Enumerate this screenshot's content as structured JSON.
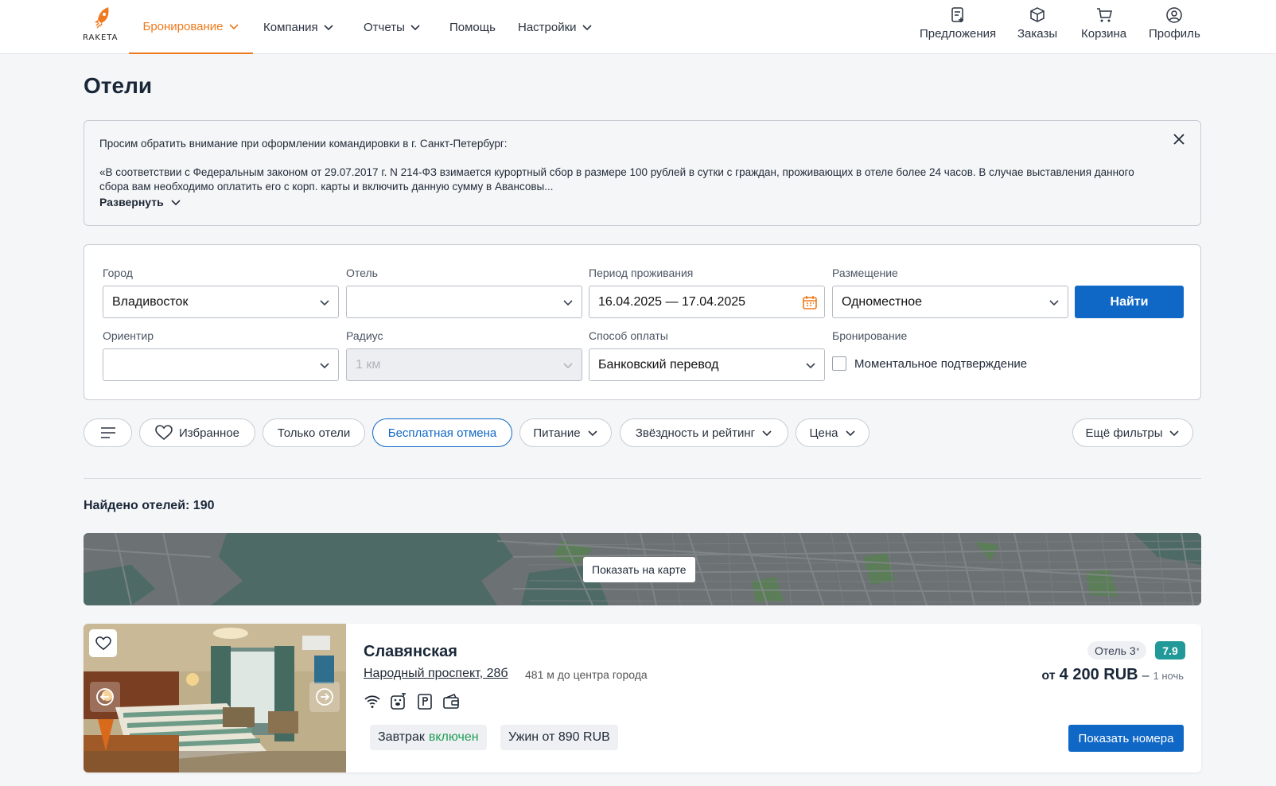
{
  "app": {
    "logo_text": "RAKETA"
  },
  "nav": {
    "items": [
      {
        "label": "Бронирование",
        "active": true,
        "dropdown": true
      },
      {
        "label": "Компания",
        "dropdown": true
      },
      {
        "label": "Отчеты",
        "dropdown": true
      },
      {
        "label": "Помощь",
        "dropdown": false
      },
      {
        "label": "Настройки",
        "dropdown": true
      }
    ],
    "right": [
      {
        "label": "Предложения",
        "icon": "offers-icon"
      },
      {
        "label": "Заказы",
        "icon": "box-icon"
      },
      {
        "label": "Корзина",
        "icon": "cart-icon"
      },
      {
        "label": "Профиль",
        "icon": "user-icon"
      }
    ]
  },
  "page": {
    "title": "Отели"
  },
  "notice": {
    "line1": "Просим обратить внимание при оформлении командировки в г. Санкт-Петербург:",
    "line2": "«В соответствии с Федеральным законом от 29.07.2017 г. N 214-ФЗ взимается курортный сбор в размере 100 рублей в сутки с граждан, проживающих в отеле более 24 часов. В случае выставления данного сбора вам необходимо оплатить его с корп. карты и включить данную сумму в Авансовы...",
    "expand_label": "Развернуть"
  },
  "search": {
    "city_label": "Город",
    "city_value": "Владивосток",
    "hotel_label": "Отель",
    "hotel_value": "",
    "period_label": "Период проживания",
    "period_value": "16.04.2025 — 17.04.2025",
    "placement_label": "Размещение",
    "placement_value": "Одноместное",
    "find_button": "Найти",
    "landmark_label": "Ориентир",
    "landmark_value": "",
    "radius_label": "Радиус",
    "radius_value": "1 км",
    "payment_label": "Способ оплаты",
    "payment_value": "Банковский перевод",
    "booking_label": "Бронирование",
    "instant_label": "Моментальное подтверждение"
  },
  "filters": {
    "favorites": "Избранное",
    "only_hotels": "Только отели",
    "free_cancel": "Бесплатная отмена",
    "meals": "Питание",
    "stars_rating": "Звёздность и рейтинг",
    "price": "Цена",
    "more": "Ещё фильтры"
  },
  "results": {
    "found": "Найдено отелей: 190"
  },
  "map": {
    "button": "Показать на карте"
  },
  "hotel": {
    "name": "Славянская",
    "address": "Народный проспект, 28б",
    "distance": "481 м до центра города",
    "type": "Отель 3",
    "type_star": "*",
    "rating": "7.9",
    "price_from": "от",
    "price_amount": "4 200 RUB",
    "price_dash": "–",
    "price_per": "1 ночь",
    "breakfast": "Завтрак",
    "breakfast_status": "включен",
    "dinner": "Ужин от 890 RUB",
    "show_rooms": "Показать номера",
    "amenities": [
      "wifi-icon",
      "pet-icon",
      "parking-icon",
      "wallet-icon"
    ]
  },
  "colors": {
    "accent": "#ee7a1c",
    "primary": "#1068c6",
    "rating": "#229999"
  }
}
